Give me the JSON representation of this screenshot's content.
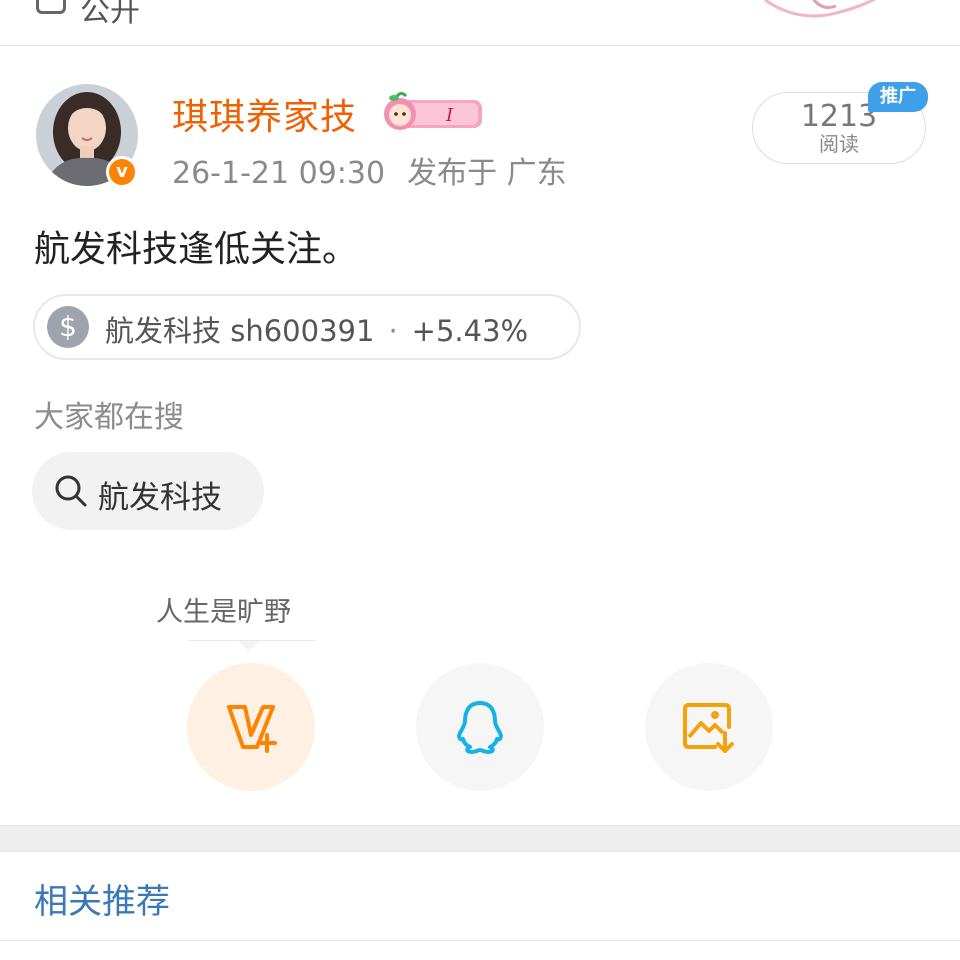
{
  "top": {
    "label": "公开"
  },
  "post": {
    "username": "琪琪养家技",
    "badge_letter": "I",
    "timestamp": "26-1-21 09:30",
    "location": "发布于 广东",
    "reads": "1213",
    "reads_label": "阅读",
    "promo_label": "推广",
    "content": "航发科技逢低关注。"
  },
  "stock": {
    "name": "航发科技",
    "code": "sh600391",
    "separator": "·",
    "change": "+5.43%"
  },
  "search": {
    "title": "大家都在搜",
    "chip": "航发科技"
  },
  "share": {
    "tooltip": "人生是旷野",
    "icons": [
      "follow-v-plus-icon",
      "qq-icon",
      "save-image-icon"
    ]
  },
  "related": {
    "title": "相关推荐"
  },
  "colors": {
    "username": "#f25f00",
    "accent_orange": "#ff8200",
    "qq_blue": "#16b1e6",
    "save_orange": "#f5a20a",
    "related_blue": "#3b78b8"
  }
}
